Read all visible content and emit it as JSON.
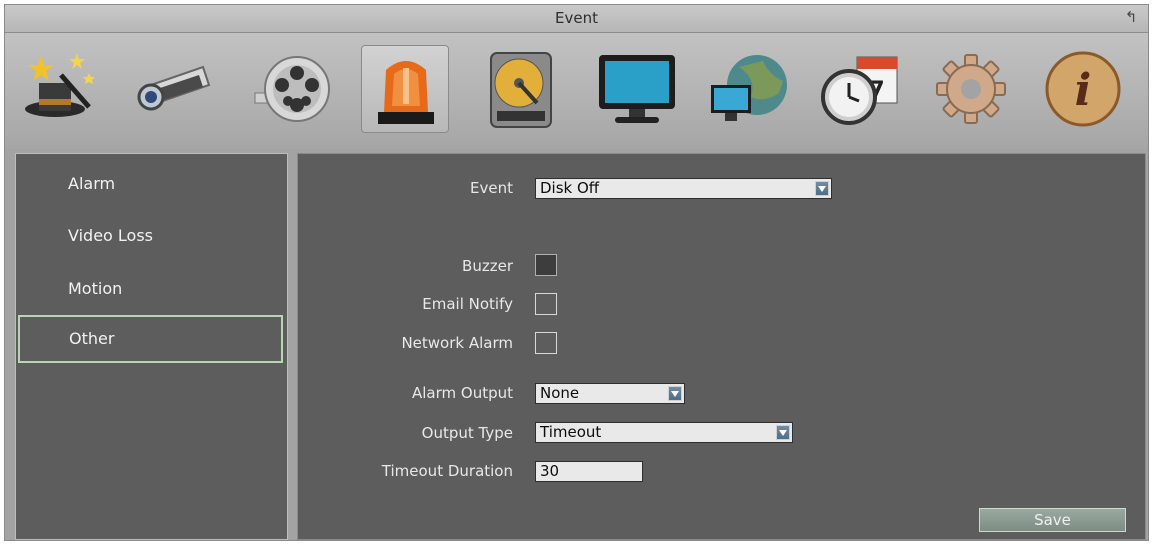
{
  "window": {
    "title": "Event"
  },
  "toolbar": {
    "icons": [
      "wizard-icon",
      "camera-icon",
      "film-reel-icon",
      "alarm-siren-icon",
      "hard-disk-icon",
      "monitor-icon",
      "network-globe-icon",
      "schedule-clock-icon",
      "gear-icon",
      "info-icon"
    ],
    "selected": "alarm-siren-icon",
    "calendar_day": "7",
    "info_glyph": "i"
  },
  "sidebar": {
    "items": [
      {
        "label": "Alarm"
      },
      {
        "label": "Video Loss"
      },
      {
        "label": "Motion"
      },
      {
        "label": "Other",
        "active": true
      }
    ]
  },
  "form": {
    "event": {
      "label": "Event",
      "value": "Disk Off"
    },
    "buzzer": {
      "label": "Buzzer",
      "checked": true
    },
    "email_notify": {
      "label": "Email Notify",
      "checked": false
    },
    "network_alarm": {
      "label": "Network Alarm",
      "checked": false
    },
    "alarm_output": {
      "label": "Alarm Output",
      "value": "None"
    },
    "output_type": {
      "label": "Output Type",
      "value": "Timeout"
    },
    "timeout_duration": {
      "label": "Timeout Duration",
      "value": "30"
    },
    "save_label": "Save"
  }
}
